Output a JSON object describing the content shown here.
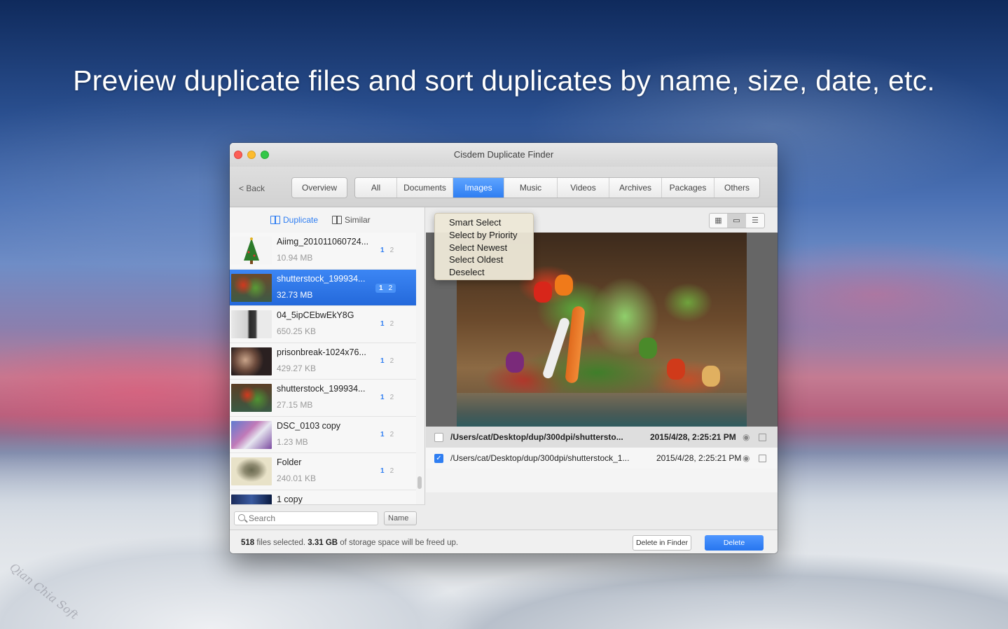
{
  "headline": "Preview duplicate files and sort duplicates by name, size, date, etc.",
  "watermark": "Qian Chia Soft",
  "window": {
    "title": "Cisdem Duplicate Finder"
  },
  "toolbar": {
    "back_label": "< Back",
    "overview_label": "Overview",
    "tabs": [
      {
        "label": "All",
        "active": false
      },
      {
        "label": "Documents",
        "active": false
      },
      {
        "label": "Images",
        "active": true
      },
      {
        "label": "Music",
        "active": false
      },
      {
        "label": "Videos",
        "active": false
      },
      {
        "label": "Archives",
        "active": false
      },
      {
        "label": "Packages",
        "active": false
      },
      {
        "label": "Others",
        "active": false
      }
    ]
  },
  "mode": {
    "duplicate_label": "Duplicate",
    "similar_label": "Similar"
  },
  "files": [
    {
      "name": "Aiimg_201011060724...",
      "size": "10.94 MB",
      "count_a": "1",
      "count_b": "2"
    },
    {
      "name": "shutterstock_199934...",
      "size": "32.73 MB",
      "count_a": "1",
      "count_b": "2"
    },
    {
      "name": "04_5ipCEbwEkY8G",
      "size": "650.25 KB",
      "count_a": "1",
      "count_b": "2"
    },
    {
      "name": "prisonbreak-1024x76...",
      "size": "429.27 KB",
      "count_a": "1",
      "count_b": "2"
    },
    {
      "name": "shutterstock_199934...",
      "size": "27.15 MB",
      "count_a": "1",
      "count_b": "2"
    },
    {
      "name": "DSC_0103 copy",
      "size": "1.23 MB",
      "count_a": "1",
      "count_b": "2"
    },
    {
      "name": "Folder",
      "size": "240.01 KB",
      "count_a": "1",
      "count_b": "2"
    },
    {
      "name": "1 copy",
      "size": "",
      "count_a": "1",
      "count_b": "2"
    }
  ],
  "search": {
    "placeholder": "Search",
    "sort_value": "Name"
  },
  "select_menu": {
    "items": [
      "Smart Select",
      "Select by Priority",
      "Select Newest",
      "Select Oldest",
      "Deselect"
    ]
  },
  "paths": [
    {
      "path": "/Users/cat/Desktop/dup/300dpi/shuttersto...",
      "date": "2015/4/28, 2:25:21 PM",
      "checked": false
    },
    {
      "path": "/Users/cat/Desktop/dup/300dpi/shutterstock_1...",
      "date": "2015/4/28, 2:25:21 PM",
      "checked": true
    }
  ],
  "footer": {
    "count": "518",
    "text_a": " files selected. ",
    "size": "3.31 GB",
    "text_b": " of storage space will be freed up.",
    "delete_in_finder_label": "Delete in Finder",
    "delete_label": "Delete"
  },
  "colors": {
    "accent": "#2f7ef2",
    "close": "#fc5f57",
    "minimize": "#fdbc2e",
    "zoom": "#33c748"
  }
}
